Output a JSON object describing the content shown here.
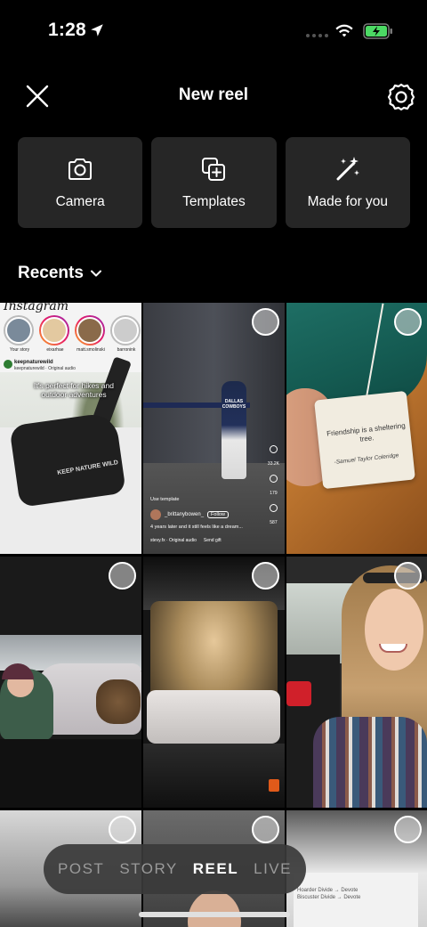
{
  "status_bar": {
    "time": "1:28",
    "icons": [
      "location-arrow-icon",
      "cellular-signal-icon",
      "wifi-icon",
      "battery-charging-icon"
    ]
  },
  "header": {
    "title": "New reel",
    "close_icon": "close-icon",
    "settings_icon": "settings-gear-icon"
  },
  "options": [
    {
      "label": "Camera",
      "icon": "camera-icon"
    },
    {
      "label": "Templates",
      "icon": "templates-icon"
    },
    {
      "label": "Made for you",
      "icon": "magic-wand-icon"
    }
  ],
  "gallery": {
    "section_label": "Recents",
    "thumbnails": [
      {
        "kind": "screenshot",
        "brand": "Instagram",
        "stories": [
          "Your story",
          "eixarhae",
          "matt.smolinski",
          "barronink"
        ],
        "account": "keepnaturewild",
        "account_sub": "keepnaturewild · Original audio",
        "caption": "It's perfect for hikes and outdoor adventures",
        "logo_text": "KEEP NATURE WILD"
      },
      {
        "kind": "screenshot",
        "jersey": "DALLAS COWBOYS",
        "template_label": "Use template",
        "username": "_brittanybowen_",
        "follow_label": "Follow",
        "caption": "4 years later and it still feels like a dream...",
        "audio": "stevy.fx · Original audio",
        "send_gift": "Send gift",
        "likes": "33.2K",
        "comments": "179",
        "shares": "587"
      },
      {
        "kind": "photo",
        "tag_text": "Friendship is a sheltering tree.",
        "tag_author": "-Samuel Taylor Coleridge"
      },
      {
        "kind": "photo"
      },
      {
        "kind": "photo"
      },
      {
        "kind": "photo"
      },
      {
        "kind": "photo"
      },
      {
        "kind": "photo"
      },
      {
        "kind": "photo",
        "board_text": [
          "Hoarder Divide → Devote",
          "Biscuster Divide → Devote"
        ]
      }
    ]
  },
  "mode_switcher": {
    "modes": [
      "POST",
      "STORY",
      "REEL",
      "LIVE"
    ],
    "active": "REEL"
  },
  "colors": {
    "background": "#000000",
    "card": "#262626",
    "text": "#ffffff",
    "inactive_mode": "#9a9a9a",
    "battery_charging": "#4cd964"
  }
}
